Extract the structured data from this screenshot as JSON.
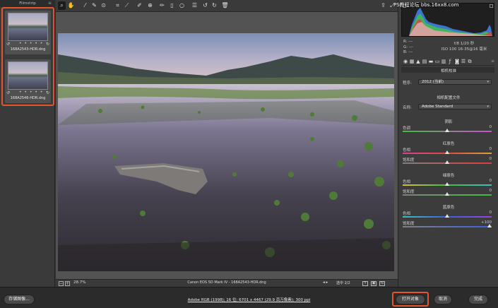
{
  "filmstrip": {
    "title": "Filmstrip",
    "menu_icon": "≡",
    "items": [
      {
        "name": "168A2543-HDR.dng",
        "dots": "• • • • •"
      },
      {
        "name": "168A2546-HDR.dng",
        "dots": "• • • • •"
      }
    ]
  },
  "toolbar": {
    "tools": [
      "zoom-tool-icon",
      "hand-tool-icon",
      "white-balance-icon",
      "color-sampler-icon",
      "target-adjust-icon",
      "crop-icon",
      "straighten-icon",
      "spot-removal-icon",
      "red-eye-icon",
      "adjustment-brush-icon",
      "graduated-filter-icon",
      "radial-filter-icon",
      "preferences-icon",
      "rotate-ccw-icon",
      "rotate-cw-icon",
      "trash-icon"
    ],
    "right_icons": [
      "export-icon",
      "fullscreen-icon"
    ]
  },
  "status": {
    "zoom_out": "−",
    "zoom_in": "+",
    "zoom": "28.7%",
    "filename": "Canon EOS 5D Mark IV  -  168A2543-HDR.dng",
    "nav": "◂ ▸",
    "selection": "选中 2/2",
    "view_buttons": [
      "Y",
      "▣",
      "⇆"
    ]
  },
  "histogram": {
    "watermark": "PS教程论坛 bbs.16xx8.com"
  },
  "readout": {
    "r": "R:    ---",
    "g": "G:    ---",
    "b": "B:    ---",
    "aperture_shutter": "f/8    1/20 秒",
    "iso_lens": "ISO 100    16-35@16 毫米"
  },
  "panel": {
    "section_title": "相机校准",
    "process_label": "程序:",
    "process_value": "2012 (当前)",
    "profile_title": "相机配置文件",
    "name_label": "名称:",
    "name_value": "Adobe Standard",
    "shadows_title": "阴影",
    "red_title": "红原色",
    "green_title": "绿原色",
    "blue_title": "蓝原色",
    "sliders": {
      "shadow_tint": {
        "label": "色调",
        "value": "0"
      },
      "red_hue": {
        "label": "色相",
        "value": "0"
      },
      "red_sat": {
        "label": "饱和度",
        "value": "0"
      },
      "green_hue": {
        "label": "色相",
        "value": "0"
      },
      "green_sat": {
        "label": "饱和度",
        "value": "0"
      },
      "blue_hue": {
        "label": "色相",
        "value": "0"
      },
      "blue_sat": {
        "label": "饱和度",
        "value": "+100"
      }
    }
  },
  "bottom": {
    "save_label": "存储图像...",
    "info": "Adobe RGB (1998); 16 位; 6701 x 4467 (29.9 百万像素); 300 ppi",
    "open_label": "打开对象",
    "cancel_label": "取消",
    "done_label": "完成"
  },
  "colors": {
    "highlight": "#e4542d",
    "panel_bg": "#3c3c3c"
  }
}
